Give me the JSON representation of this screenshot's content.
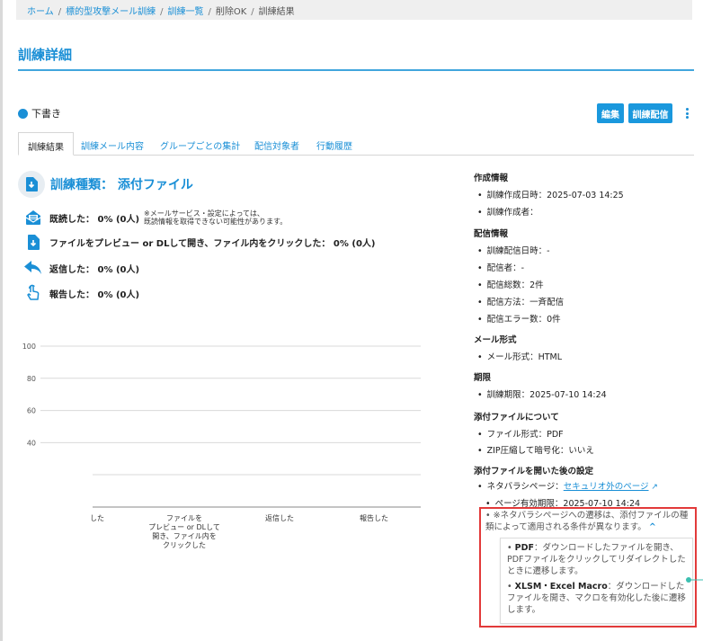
{
  "breadcrumb": [
    {
      "label": "ホーム",
      "link": true
    },
    {
      "label": "標的型攻撃メール訓練",
      "link": true
    },
    {
      "label": "訓練一覧",
      "link": true
    },
    {
      "label": "削除OK",
      "link": false
    },
    {
      "label": "訓練結果",
      "link": false
    }
  ],
  "page_title": "訓練詳細",
  "status": {
    "label": "下書き",
    "color": "#1a8fd6"
  },
  "actions": {
    "edit": "編集",
    "deliver": "訓練配信"
  },
  "tabs": [
    "訓練結果",
    "訓練メール内容",
    "グループごとの集計",
    "配信対象者",
    "行動履歴"
  ],
  "training_type": "訓練種類： 添付ファイル",
  "metrics": [
    {
      "icon": "envelope-open-icon",
      "label": "既読した： 0% (0人)"
    },
    {
      "icon": "file-download-icon",
      "label": "ファイルをプレビュー or DLして開き、ファイル内をクリックした： 0% (0人)"
    },
    {
      "icon": "reply-icon",
      "label": "返信した： 0% (0人)"
    },
    {
      "icon": "pointer-hand-icon",
      "label": "報告した： 0% (0人)"
    }
  ],
  "read_note": [
    "※メールサービス・設定によっては、",
    "既読情報を取得できない可能性があります。"
  ],
  "chart_data": {
    "type": "bar",
    "categories": [
      "した",
      "ファイルを\nプレビュー or DLして\n開き、ファイル内を\nクリックした",
      "返信した",
      "報告した"
    ],
    "values": [
      0,
      0,
      0,
      0
    ],
    "ylim": [
      0,
      100
    ],
    "yticks": [
      40,
      60,
      80,
      100
    ],
    "grid": true
  },
  "sidebar": {
    "sections": [
      {
        "heading": "作成情報",
        "items": [
          "訓練作成日時：2025-07-03 14:25",
          "訓練作成者："
        ]
      },
      {
        "heading": "配信情報",
        "items": [
          "訓練配信日時：-",
          "配信者：-",
          "配信総数：2件",
          "配信方法：一斉配信",
          "配信エラー数：0件"
        ]
      },
      {
        "heading": "メール形式",
        "items": [
          "メール形式：HTML"
        ]
      },
      {
        "heading": "期限",
        "items": [
          "訓練期限：2025-07-10 14:24"
        ]
      },
      {
        "heading": "添付ファイルについて",
        "items": [
          "ファイル形式：PDF",
          "ZIP圧縮して暗号化：いいえ"
        ]
      },
      {
        "heading": "添付ファイルを開いた後の設定",
        "items": []
      }
    ],
    "neta_label": "ネタバラシページ：",
    "neta_link": "セキュリオ外のページ",
    "page_expiry": "ページ有効期限：2025-07-10 14:24",
    "warning": "※ネタバラシページへの遷移は、添付ファイルの種類によって適用される条件が異なります。",
    "conditions": [
      {
        "term": "PDF",
        "text": "：ダウンロードしたファイルを開き、PDFファイルをクリックしてリダイレクトしたときに遷移します。"
      },
      {
        "term": "XLSM・Excel Macro",
        "text": "：ダウンロードしたファイルを開き、マクロを有効化した後に遷移します。"
      }
    ]
  },
  "colors": {
    "accent": "#1a8fd6",
    "highlight": "#e23a3a",
    "connector": "#3cbfb0"
  }
}
